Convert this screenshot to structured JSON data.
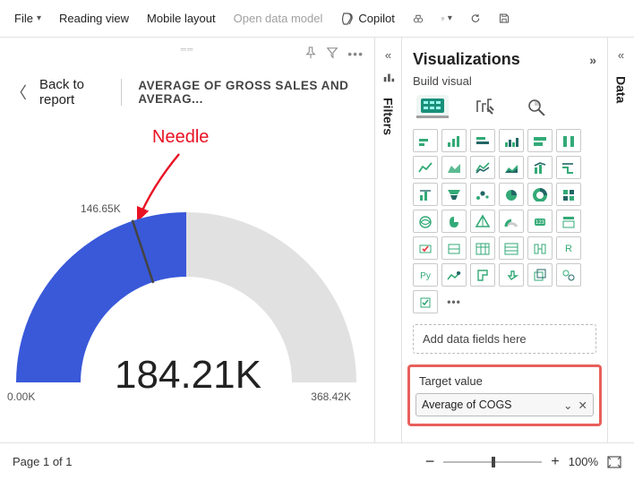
{
  "toolbar": {
    "file": "File",
    "reading_view": "Reading view",
    "mobile_layout": "Mobile layout",
    "open_model": "Open data model",
    "copilot": "Copilot"
  },
  "canvas": {
    "back": "Back to report",
    "chart_title": "AVERAGE OF GROSS SALES AND AVERAG..."
  },
  "annotation": {
    "needle": "Needle"
  },
  "filters_pane": {
    "title": "Filters"
  },
  "viz_pane": {
    "title": "Visualizations",
    "subtitle": "Build visual",
    "values_well": "Add data fields here",
    "target_label": "Target value",
    "target_field": "Average of COGS"
  },
  "data_pane": {
    "title": "Data"
  },
  "statusbar": {
    "page": "Page 1 of 1",
    "zoom": "100%"
  },
  "chart_data": {
    "type": "gauge",
    "value": 184.21,
    "min": 0.0,
    "max": 368.42,
    "target": 146.65,
    "unit_suffix": "K",
    "display_value": "184.21K",
    "min_label": "0.00K",
    "max_label": "368.42K",
    "target_label": "146.65K",
    "fill_color": "#3959d9",
    "track_color": "#e1e1e1",
    "needle_color": "#444444"
  }
}
